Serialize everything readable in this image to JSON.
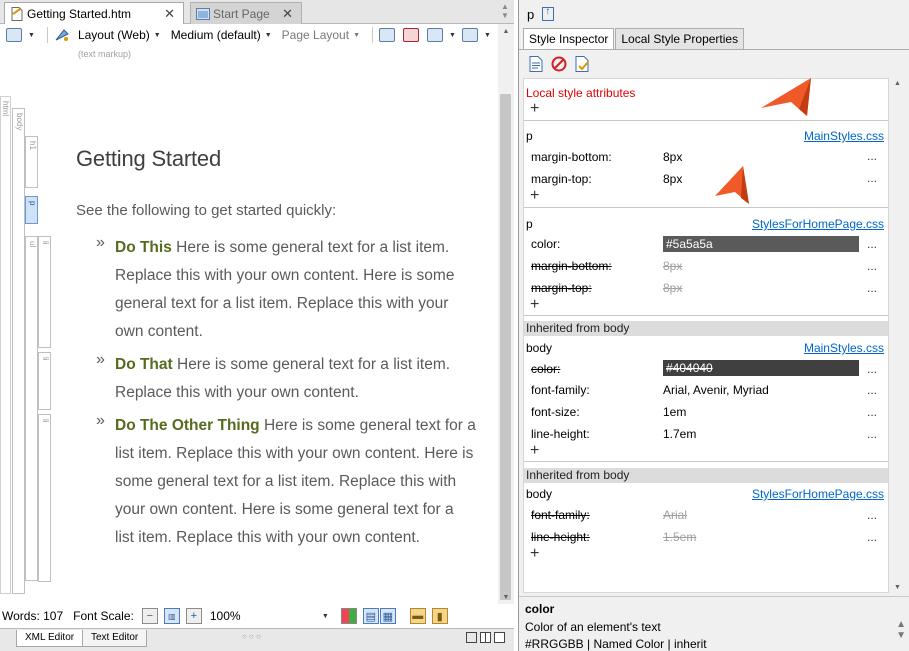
{
  "left_tabs": [
    {
      "label": "Getting Started.htm",
      "active": true
    },
    {
      "label": "Start Page",
      "active": false
    }
  ],
  "toolbar": {
    "layout": "Layout (Web)",
    "medium": "Medium (default)",
    "page_layout": "Page Layout",
    "markup_label": "(text markup)"
  },
  "structure_bar": {
    "html": "html",
    "body": "body",
    "h1": "h1",
    "p": "p",
    "ul": "ul",
    "li": "li"
  },
  "document": {
    "title": "Getting Started",
    "intro": "See the following to get started quickly:",
    "bullet": "»",
    "items": [
      {
        "lead": "Do This",
        "text": " Here is some general text for a list item. Replace this with your own content. Here is some general text for a list item. Replace this with your own content."
      },
      {
        "lead": "Do That",
        "text": " Here is some general text for a list item. Replace this with your own content."
      },
      {
        "lead": "Do The Other Thing",
        "text": " Here is some general text for a list item. Replace this with your own content. Here is some general text for a list item. Replace this with your own content. Here is some general text for a list item. Replace this with your own content."
      }
    ]
  },
  "status": {
    "words": "Words: 107",
    "font_scale": "Font Scale:",
    "zoom": "100%"
  },
  "bottom_tabs": [
    "XML Editor",
    "Text Editor"
  ],
  "right": {
    "element": "p",
    "tabs": [
      {
        "label": "Style Inspector",
        "active": true
      },
      {
        "label": "Local Style Properties",
        "active": false
      }
    ],
    "local_label": "Local style attributes",
    "sections": {
      "s1": {
        "selector": "p",
        "source": "MainStyles.css",
        "props": [
          {
            "name": "margin-bottom:",
            "value": "8px"
          },
          {
            "name": "margin-top:",
            "value": "8px"
          }
        ]
      },
      "s2": {
        "selector": "p",
        "source": "StylesForHomePage.css",
        "props": [
          {
            "name": "color:",
            "value": "#5a5a5a"
          },
          {
            "name": "margin-bottom:",
            "value": "8px"
          },
          {
            "name": "margin-top:",
            "value": "8px"
          }
        ]
      },
      "s3": {
        "inherited": "Inherited from body",
        "selector": "body",
        "source": "MainStyles.css",
        "props": [
          {
            "name": "color:",
            "value": "#404040"
          },
          {
            "name": "font-family:",
            "value": "Arial, Avenir, Myriad"
          },
          {
            "name": "font-size:",
            "value": "1em"
          },
          {
            "name": "line-height:",
            "value": "1.7em"
          }
        ]
      },
      "s4": {
        "inherited": "Inherited from body",
        "selector": "body",
        "source": "StylesForHomePage.css",
        "props": [
          {
            "name": "font-family:",
            "value": "Arial"
          },
          {
            "name": "line-height:",
            "value": "1.5em"
          }
        ]
      }
    },
    "dots": "...",
    "plus": "+",
    "description": {
      "title": "color",
      "text": "Color of an element's text",
      "syntax": "#RRGGBB | Named Color | inherit"
    }
  },
  "colors": {
    "callout": "#f05a28",
    "swatch_5a5a5a": "#5a5a5a",
    "swatch_404040": "#404040",
    "link": "#0066cc",
    "local_label": "#e00000",
    "lead_text": "#556b1e"
  }
}
